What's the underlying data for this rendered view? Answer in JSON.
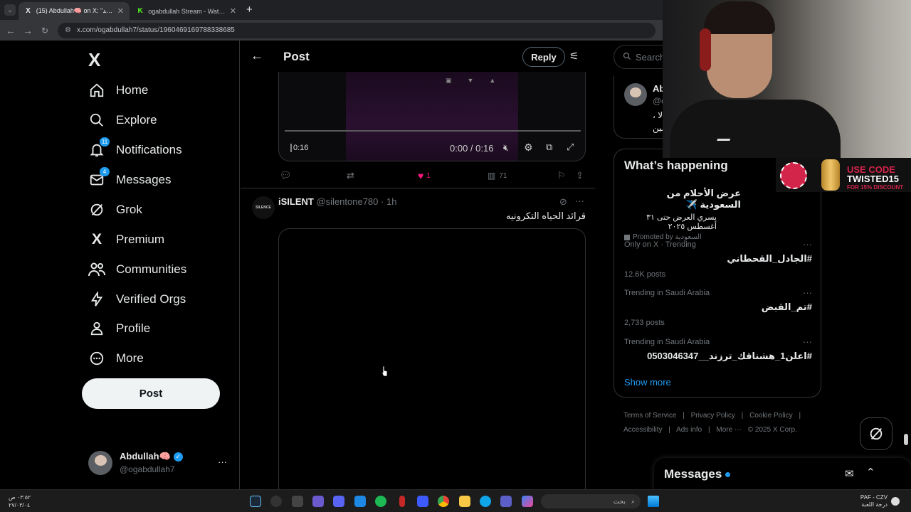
{
  "browser": {
    "tabs": [
      {
        "title": "(15) Abdullah🧠 on X: \"قرائد...",
        "favicon": "X",
        "active": true
      },
      {
        "title": "ogabdullah Stream - Watch Live",
        "favicon": "K",
        "active": false
      }
    ],
    "new_tab": "+",
    "url": "x.com/ogabdullah7/status/1960469169788338685"
  },
  "nav": {
    "logo": "X",
    "items": [
      {
        "label": "Home",
        "icon": "home-icon"
      },
      {
        "label": "Explore",
        "icon": "search-icon"
      },
      {
        "label": "Notifications",
        "icon": "bell-icon",
        "badge": "11"
      },
      {
        "label": "Messages",
        "icon": "envelope-icon",
        "badge": "4"
      },
      {
        "label": "Grok",
        "icon": "grok-icon"
      },
      {
        "label": "Premium",
        "icon": "x-logo-icon"
      },
      {
        "label": "Communities",
        "icon": "people-icon"
      },
      {
        "label": "Verified Orgs",
        "icon": "lightning-icon"
      },
      {
        "label": "Profile",
        "icon": "person-icon"
      },
      {
        "label": "More",
        "icon": "more-circle-icon"
      }
    ],
    "post_button": "Post",
    "account": {
      "name": "Abdullah🧠",
      "handle": "@ogabdullah7",
      "more": "···"
    }
  },
  "main": {
    "header_title": "Post",
    "reply_label": "Reply",
    "video1": {
      "current": "0:00 / 0:16",
      "duration_overlay": "0:16"
    },
    "actions": {
      "likes": "1",
      "views": "71"
    },
    "tweet2": {
      "name": "iSILENT",
      "handle": "@silentone780",
      "time": "· 1h",
      "text": "قرائد الحياه التكرونيه",
      "more": "···",
      "avatar_text": "SILENCE"
    }
  },
  "right": {
    "search_placeholder": "Search",
    "profile_card": {
      "name": "Ab",
      "handle": "@c",
      "line1": "، الا",
      "line2": "بين"
    },
    "whats_happening": "What’s happening",
    "promoted": {
      "title": "عرض الأحلام من السعودية ✈️",
      "subtitle": "يسري العرض حتى ٣١ أغسطس ٢٠٢٥",
      "by": "Promoted by السعودية"
    },
    "trends": [
      {
        "meta": "Only on X · Trending",
        "title": "#الجادل_القحطاني",
        "count": "12.6K posts"
      },
      {
        "meta": "Trending in Saudi Arabia",
        "title": "#تم_القبض",
        "count": "2,733 posts"
      },
      {
        "meta": "Trending in Saudi Arabia",
        "title": "#اعلن1_هشناقك_ترزند__0503046347",
        "count": ""
      }
    ],
    "show_more": "Show more",
    "footer": [
      "Terms of Service",
      "|",
      "Privacy Policy",
      "|",
      "Cookie Policy",
      "|",
      "Accessibility",
      "|",
      "Ads info",
      "|",
      "More ···",
      "© 2025 X Corp."
    ]
  },
  "promo": {
    "line1": "USE CODE",
    "line2": "TWISTED15",
    "line3": "FOR 15% DISCOUNT"
  },
  "messages_dock": {
    "label": "Messages"
  },
  "taskbar": {
    "clock_time": "٠٣:٥٢ ص",
    "clock_date": "٢٧/٠٣/٠٤",
    "search_placeholder": "بحث",
    "tray_line1": "PAF - CZV",
    "tray_line2": "درجة اللعبة"
  },
  "colors": {
    "accent": "#1d9bf0",
    "like": "#f91880",
    "promo": "#d3244a"
  }
}
